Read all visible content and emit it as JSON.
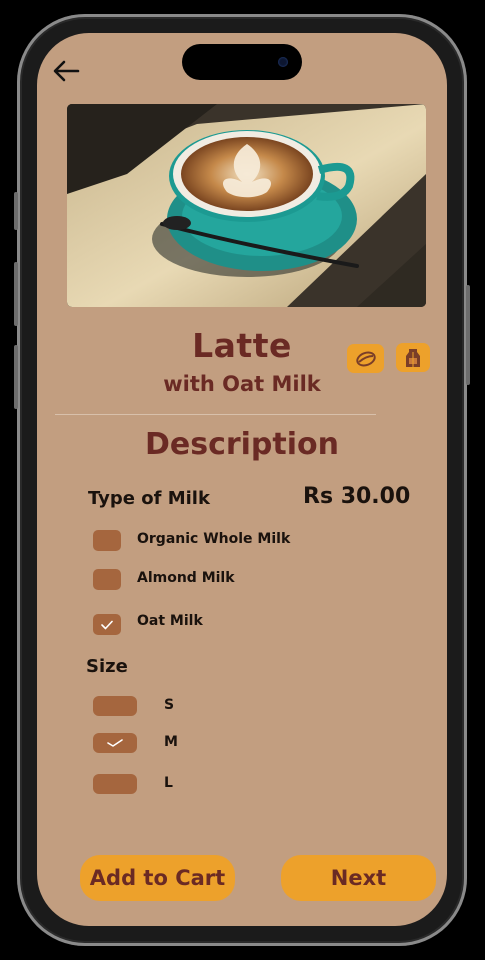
{
  "product": {
    "name": "Latte",
    "variant": "with Oat Milk",
    "price": "Rs 30.00"
  },
  "header": {
    "back_icon": "arrow-left-icon"
  },
  "badges": [
    {
      "icon": "coffee-bean-icon"
    },
    {
      "icon": "milk-carton-icon"
    }
  ],
  "description": {
    "title": "Description",
    "milk_label": "Type of Milk",
    "milk_options": [
      {
        "label": "Organic Whole Milk",
        "checked": false
      },
      {
        "label": "Almond Milk",
        "checked": false
      },
      {
        "label": "Oat Milk",
        "checked": true
      }
    ],
    "size_label": "Size",
    "sizes": [
      {
        "label": "S",
        "checked": false
      },
      {
        "label": "M",
        "checked": true
      },
      {
        "label": "L",
        "checked": false
      }
    ]
  },
  "actions": {
    "add_to_cart": "Add to Cart",
    "next": "Next"
  },
  "colors": {
    "background": "#c29e80",
    "accent": "#eda12b",
    "title": "#6a2a24",
    "checkbox": "#a5663e"
  }
}
